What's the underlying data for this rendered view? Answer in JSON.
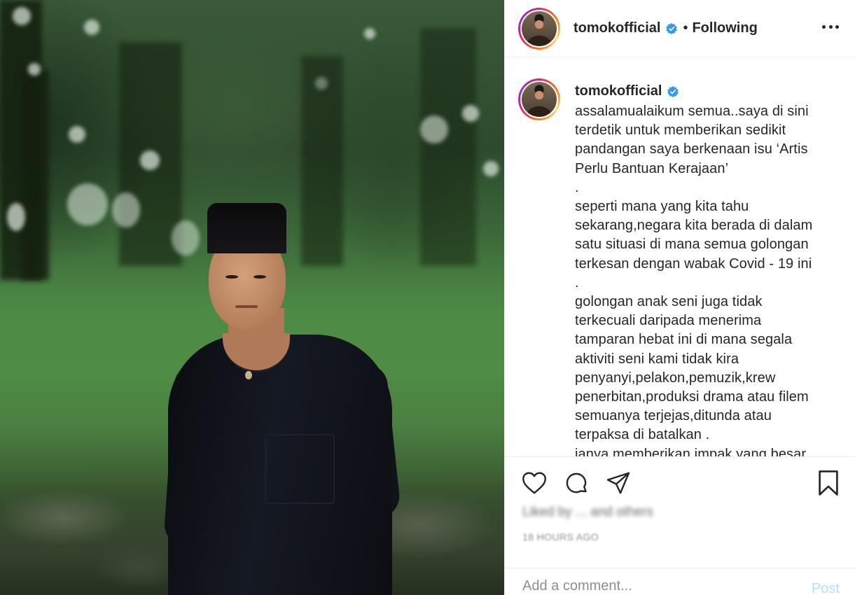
{
  "post": {
    "username": "tomokofficial",
    "separator": "•",
    "follow_status": "Following",
    "caption": "assalamualaikum semua..saya di sini\nterdetik untuk memberikan sedikit\npandangan saya berkenaan isu ‘Artis\nPerlu Bantuan Kerajaan’\n.\nseperti mana yang kita tahu\nsekarang,negara kita berada di dalam\nsatu situasi di mana semua golongan\nterkesan dengan wabak Covid - 19 ini\n.\ngolongan anak seni juga tidak\nterkecuali daripada menerima\ntamparan hebat ini di mana segala\naktiviti seni kami tidak kira\npenyanyi,pelakon,pemuzik,krew\npenerbitan,produksi drama atau filem\nsemuanya terjejas,ditunda atau\nterpaksa di batalkan .\njanya memberikan impak yang besar",
    "likes_text": "Liked by ... and others",
    "timestamp": "18 HOURS AGO"
  },
  "composer": {
    "placeholder": "Add a comment...",
    "post_label": "Post"
  },
  "icons": {
    "verified": "verified-badge-icon",
    "more": "more-options-icon",
    "like": "heart-icon",
    "comment": "comment-icon",
    "share": "paper-plane-icon",
    "save": "bookmark-icon"
  },
  "colors": {
    "verified_blue": "#3897f0",
    "post_button_disabled": "#b2dffc",
    "text_primary": "#262626",
    "text_secondary": "#8e8e8e"
  }
}
